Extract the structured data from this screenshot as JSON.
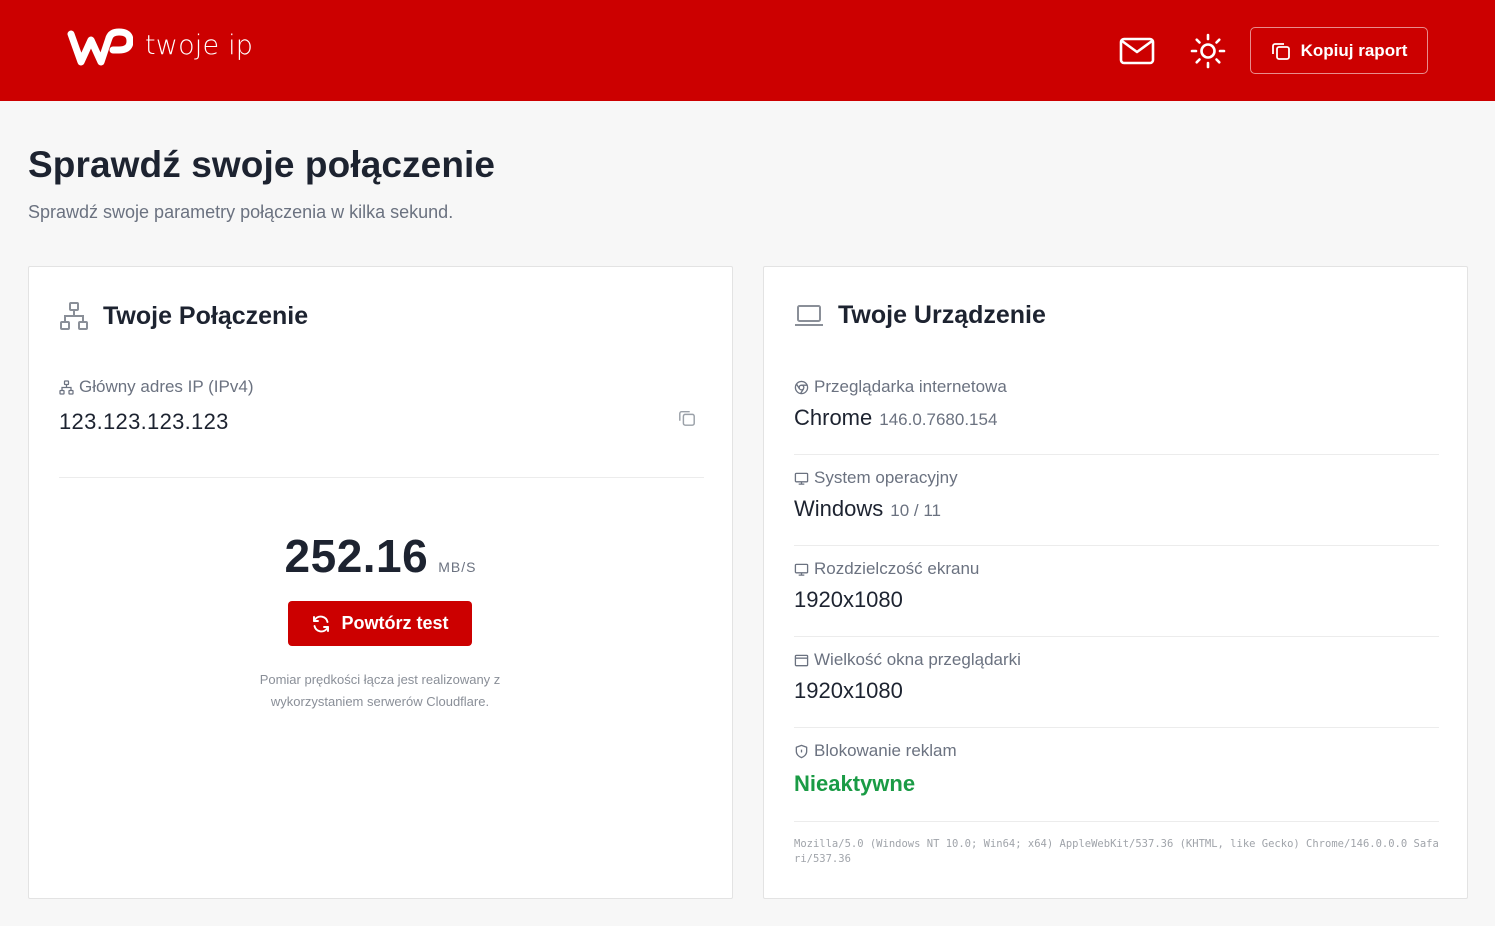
{
  "header": {
    "logo_text": "twoje ip",
    "mail_icon": "mail-icon",
    "theme_icon": "sun-icon",
    "copy_report_label": "Kopiuj raport",
    "bg_color": "#cc0000"
  },
  "page": {
    "title": "Sprawdź swoje połączenie",
    "subtitle": "Sprawdź swoje parametry połączenia w kilka sekund."
  },
  "connection": {
    "title": "Twoje Połączenie",
    "ip_label": "Główny adres IP (IPv4)",
    "ip_value": "123.123.123.123",
    "speed_value": "252.16",
    "speed_unit": "MB/S",
    "retry_label": "Powtórz test",
    "note": "Pomiar prędkości łącza jest realizowany z wykorzystaniem serwerów Cloudflare."
  },
  "device": {
    "title": "Twoje Urządzenie",
    "browser_label": "Przeglądarka internetowa",
    "browser_name": "Chrome",
    "browser_version": "146.0.7680.154",
    "os_label": "System operacyjny",
    "os_name": "Windows",
    "os_version": "10 / 11",
    "screen_label": "Rozdzielczość ekranu",
    "screen_value": "1920x1080",
    "window_label": "Wielkość okna przeglądarki",
    "window_value": "1920x1080",
    "adblock_label": "Blokowanie reklam",
    "adblock_value": "Nieaktywne",
    "adblock_color": "#1a9b45",
    "user_agent": "Mozilla/5.0 (Windows NT 10.0; Win64; x64) AppleWebKit/537.36 (KHTML, like Gecko) Chrome/146.0.0.0 Safari/537.36"
  }
}
